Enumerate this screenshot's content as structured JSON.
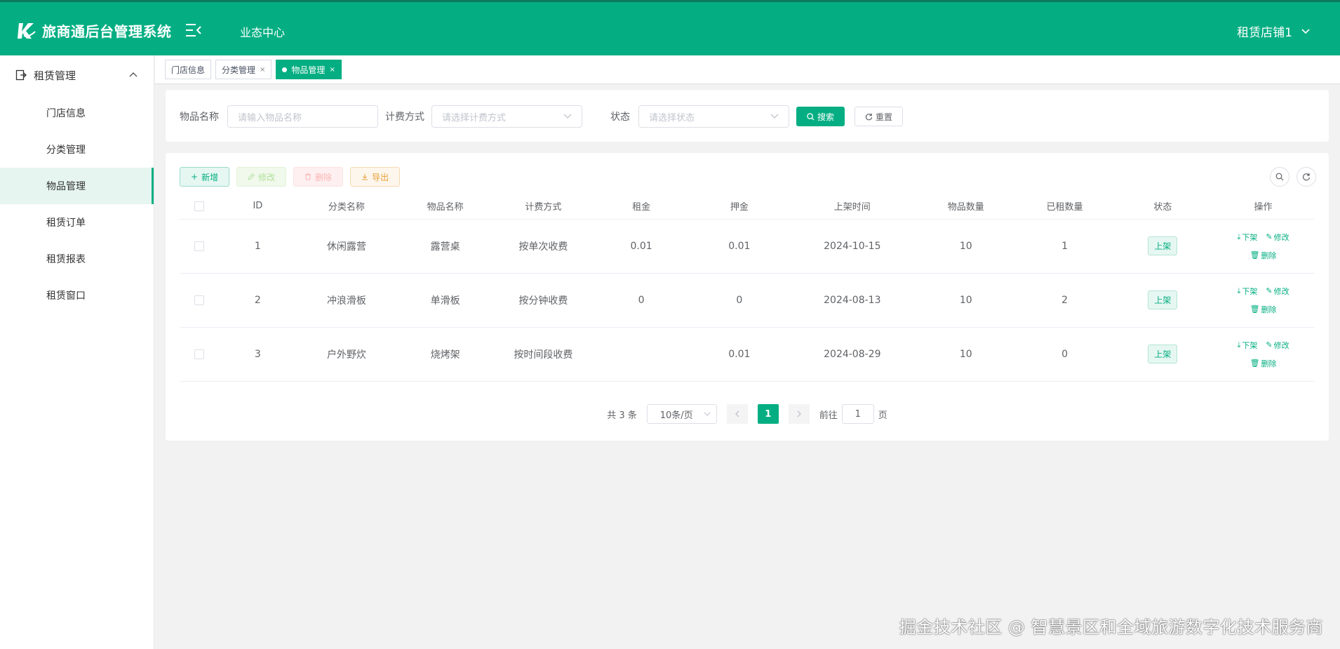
{
  "header": {
    "brand_title": "旅商通后台管理系统",
    "nav_label": "业态中心",
    "user_label": "租赁店铺1"
  },
  "sidebar": {
    "group_label": "租赁管理",
    "items": [
      {
        "label": "门店信息",
        "active": false
      },
      {
        "label": "分类管理",
        "active": false
      },
      {
        "label": "物品管理",
        "active": true
      },
      {
        "label": "租赁订单",
        "active": false
      },
      {
        "label": "租赁报表",
        "active": false
      },
      {
        "label": "租赁窗口",
        "active": false
      }
    ]
  },
  "tabs": [
    {
      "label": "门店信息"
    },
    {
      "label": "分类管理",
      "close": "×"
    },
    {
      "label": "物品管理",
      "close": "×"
    }
  ],
  "search": {
    "name_label": "物品名称",
    "name_placeholder": "请输入物品名称",
    "billing_label": "计费方式",
    "billing_placeholder": "请选择计费方式",
    "status_label": "状态",
    "status_placeholder": "请选择状态",
    "search_btn": "搜索",
    "reset_btn": "重置"
  },
  "toolbar": {
    "add": "新增",
    "edit": "修改",
    "delete": "删除",
    "export": "导出"
  },
  "table": {
    "columns": [
      "ID",
      "分类名称",
      "物品名称",
      "计费方式",
      "租金",
      "押金",
      "上架时间",
      "物品数量",
      "已租数量",
      "状态",
      "操作"
    ],
    "rows": [
      {
        "id": "1",
        "category": "休闲露营",
        "name": "露营桌",
        "billing": "按单次收费",
        "rent": "0.01",
        "deposit": "0.01",
        "date": "2024-10-15",
        "qty": "10",
        "rented": "1",
        "status": "上架"
      },
      {
        "id": "2",
        "category": "冲浪滑板",
        "name": "单滑板",
        "billing": "按分钟收费",
        "rent": "0",
        "deposit": "0",
        "date": "2024-08-13",
        "qty": "10",
        "rented": "2",
        "status": "上架"
      },
      {
        "id": "3",
        "category": "户外野炊",
        "name": "烧烤架",
        "billing": "按时间段收费",
        "rent": "",
        "deposit": "0.01",
        "date": "2024-08-29",
        "qty": "10",
        "rented": "0",
        "status": "上架"
      }
    ],
    "ops": {
      "down": "下架",
      "edit": "修改",
      "delete": "删除"
    }
  },
  "pager": {
    "total": "共 3 条",
    "page_size": "10条/页",
    "current_page": "1",
    "goto_label": "前往",
    "goto_value": "1",
    "page_suffix": "页"
  },
  "watermark": "掘金技术社区 @ 智慧景区和全域旅游数字化技术服务商",
  "colors": {
    "accent": "#04ae82"
  }
}
